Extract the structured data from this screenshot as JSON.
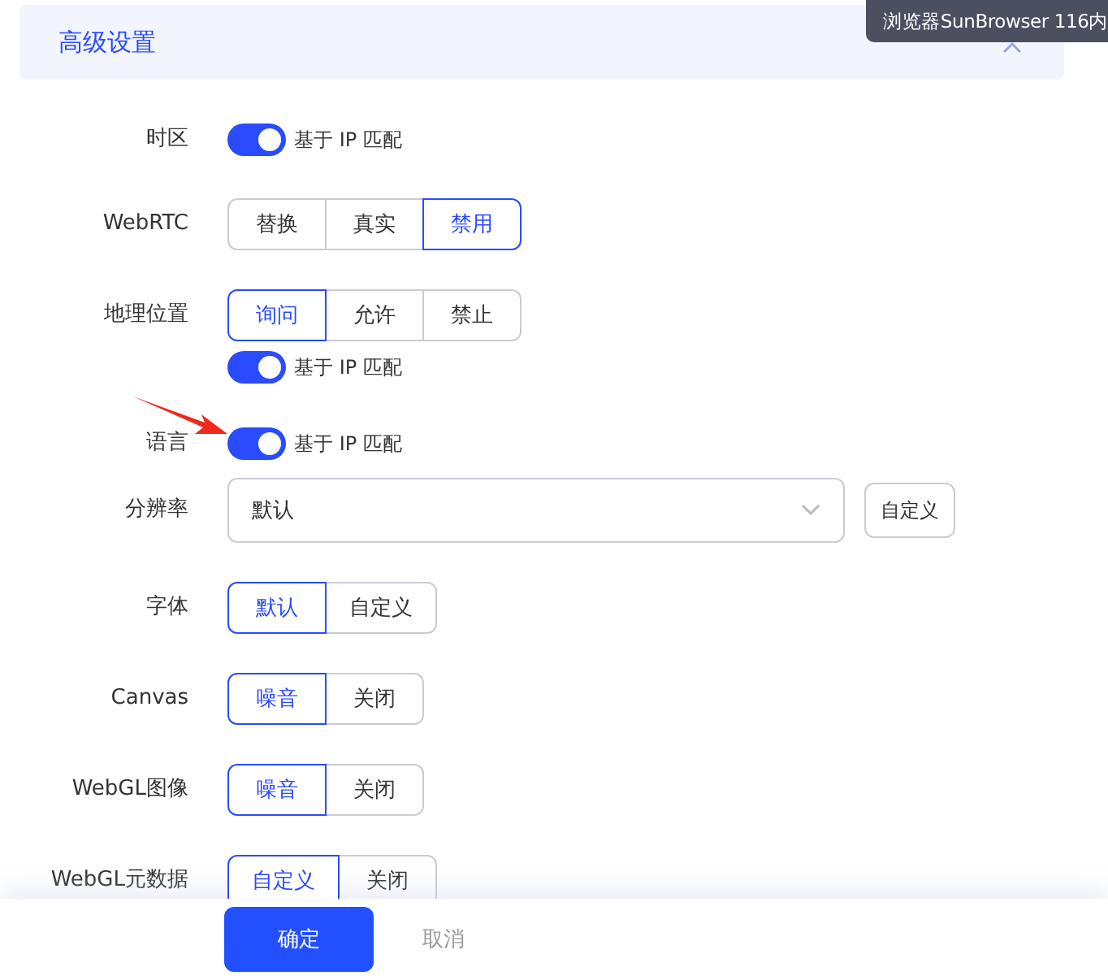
{
  "header": {
    "title": "高级设置",
    "expanded": true
  },
  "tooltip": {
    "text": "浏览器SunBrowser 116内"
  },
  "settings": [
    {
      "kind": "toggle",
      "label": "时区",
      "toggle": {
        "on": true,
        "label": "基于 IP 匹配"
      }
    },
    {
      "kind": "segmented",
      "label": "WebRTC",
      "options": [
        {
          "label": "替换",
          "selected": false
        },
        {
          "label": "真实",
          "selected": false
        },
        {
          "label": "禁用",
          "selected": true
        }
      ]
    },
    {
      "kind": "segmented",
      "label": "地理位置",
      "options": [
        {
          "label": "询问",
          "selected": true
        },
        {
          "label": "允许",
          "selected": false
        },
        {
          "label": "禁止",
          "selected": false
        }
      ],
      "toggle": {
        "on": true,
        "label": "基于 IP 匹配"
      }
    },
    {
      "kind": "toggle",
      "label": "语言",
      "toggle": {
        "on": true,
        "label": "基于 IP 匹配"
      },
      "annotated": true
    },
    {
      "kind": "select",
      "label": "分辨率",
      "value": "默认",
      "button": "自定义"
    },
    {
      "kind": "segmented",
      "label": "字体",
      "options": [
        {
          "label": "默认",
          "selected": true
        },
        {
          "label": "自定义",
          "selected": false
        }
      ]
    },
    {
      "kind": "segmented",
      "label": "Canvas",
      "options": [
        {
          "label": "噪音",
          "selected": true
        },
        {
          "label": "关闭",
          "selected": false
        }
      ]
    },
    {
      "kind": "segmented",
      "label": "WebGL图像",
      "options": [
        {
          "label": "噪音",
          "selected": true
        },
        {
          "label": "关闭",
          "selected": false
        }
      ]
    },
    {
      "kind": "segmented",
      "label": "WebGL元数据",
      "options": [
        {
          "label": "自定义",
          "selected": true
        },
        {
          "label": "关闭",
          "selected": false
        }
      ]
    }
  ],
  "footer": {
    "confirm": "确定",
    "cancel": "取消"
  }
}
